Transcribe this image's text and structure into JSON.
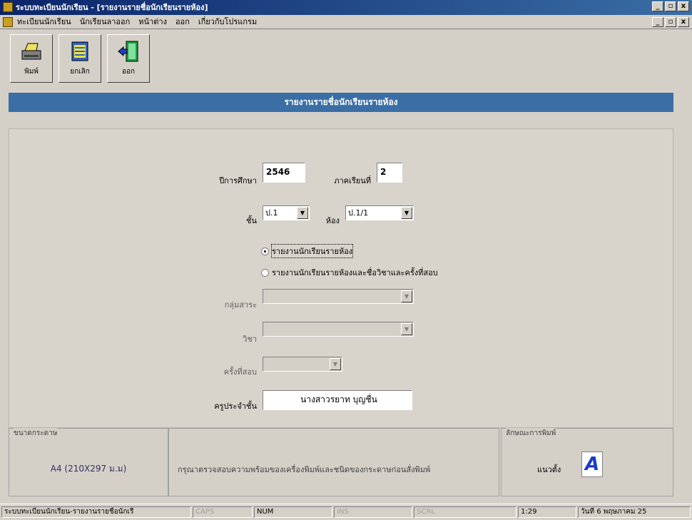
{
  "window": {
    "title": "ระบบทะเบียนนักเรียน - [รายงานรายชื่อนักเรียนรายห้อง]",
    "min": "_",
    "max": "▫",
    "close": "x"
  },
  "menu": [
    "ทะเบียนนักเรียน",
    "นักเรียนลาออก",
    "หน้าต่าง",
    "ออก",
    "เกี่ยวกับโปรแกรม"
  ],
  "toolbar": {
    "print": "พิมพ์",
    "cancel": "ยกเลิก",
    "exit": "ออก"
  },
  "header": "รายงานรายชื่อนักเรียนรายห้อง",
  "form": {
    "year_label": "ปีการศึกษา",
    "year_value": "2546",
    "term_label": "ภาคเรียนที่",
    "term_value": "2",
    "class_label": "ชั้น",
    "class_value": "ป.1",
    "room_label": "ห้อง",
    "room_value": "ป.1/1",
    "radio1": "รายงานนักเรียนรายห้อง",
    "radio2": "รายงานนักเรียนรายห้องและชื่อวิชาและครั้งที่สอบ",
    "group_label": "กลุ่มสาระ",
    "subject_label": "วิชา",
    "exam_label": "ครั้งที่สอบ",
    "teacher_label": "ครูประจำชั้น",
    "teacher_value": "นางสาวรยาท บุญชื่น"
  },
  "bottom": {
    "paper_title": "ขนาดกระดาษ",
    "paper_value": "A4 (210X297 ม.ม)",
    "notice": "กรุณาตรวจสอบความพร้อมของเครื่องพิมพ์และชนิดของกระดาษก่อนสั่งพิมพ์",
    "print_style_title": "ลักษณะการพิมพ์",
    "orientation": "แนวตั้ง",
    "orientation_glyph": "A"
  },
  "status": {
    "app": "ระบบทะเบียนนักเรียน-รายงานรายชื่อนักเรี",
    "caps": "CAPS",
    "num": "NUM",
    "ins": "INS",
    "scrl": "SCRL",
    "time": "1:29",
    "date": "วันที่ 6 พฤษภาคม 25"
  }
}
